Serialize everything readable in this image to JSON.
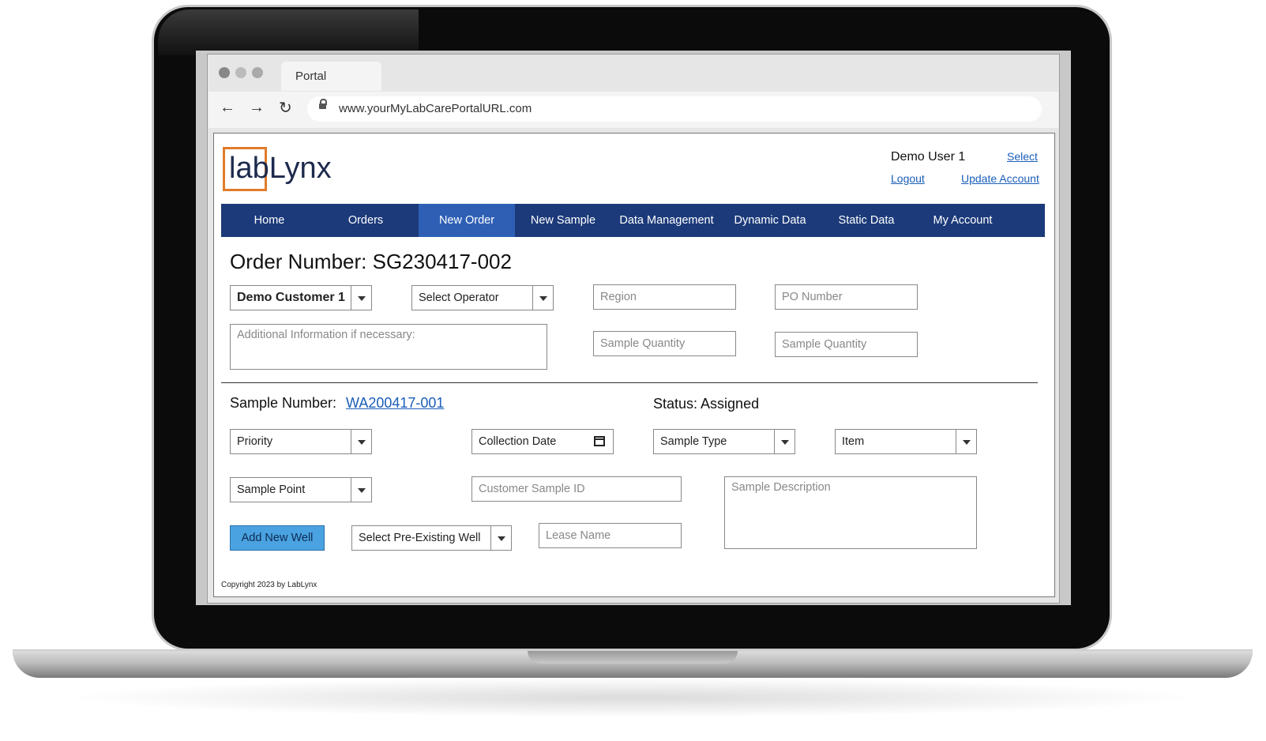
{
  "browser": {
    "tab_title": "Portal",
    "url": "www.yourMyLabCarePortalURL.com"
  },
  "header": {
    "logo_part1": "lab",
    "logo_part2": "Lynx",
    "user_name": "Demo User 1",
    "select_link": "Select",
    "logout_link": "Logout",
    "update_account_link": "Update Account"
  },
  "nav": {
    "items": [
      "Home",
      "Orders",
      "New Order",
      "New Sample",
      "Data Management",
      "Dynamic Data",
      "Static Data",
      "My Account"
    ],
    "active": "New Order"
  },
  "order": {
    "title": "Order Number: SG230417-002",
    "customer_select": "Demo Customer 1",
    "operator_select": "Select Operator",
    "region_placeholder": "Region",
    "po_placeholder": "PO Number",
    "additional_info_placeholder": "Additional Information if necessary:",
    "sample_qty_placeholder_1": "Sample Quantity",
    "sample_qty_placeholder_2": "Sample Quantity"
  },
  "sample": {
    "number_label": "Sample Number:",
    "number_value": "WA200417-001",
    "status": "Status: Assigned",
    "priority_select": "Priority",
    "collection_date": "Collection Date",
    "sample_type_select": "Sample Type",
    "item_select": "Item",
    "sample_point_select": "Sample Point",
    "customer_sample_id_placeholder": "Customer Sample ID",
    "sample_description_placeholder": "Sample Description",
    "add_well_button": "Add New Well",
    "preexisting_well_select": "Select Pre-Existing Well",
    "lease_name_placeholder": "Lease Name"
  },
  "footer": {
    "copyright": "Copyright 2023 by LabLynx"
  },
  "colors": {
    "nav_bg": "#1c3a7a",
    "nav_active": "#2e5fb5",
    "button_bg": "#4aa3e0",
    "logo_orange": "#e07b2a",
    "link": "#1a5eb8"
  }
}
